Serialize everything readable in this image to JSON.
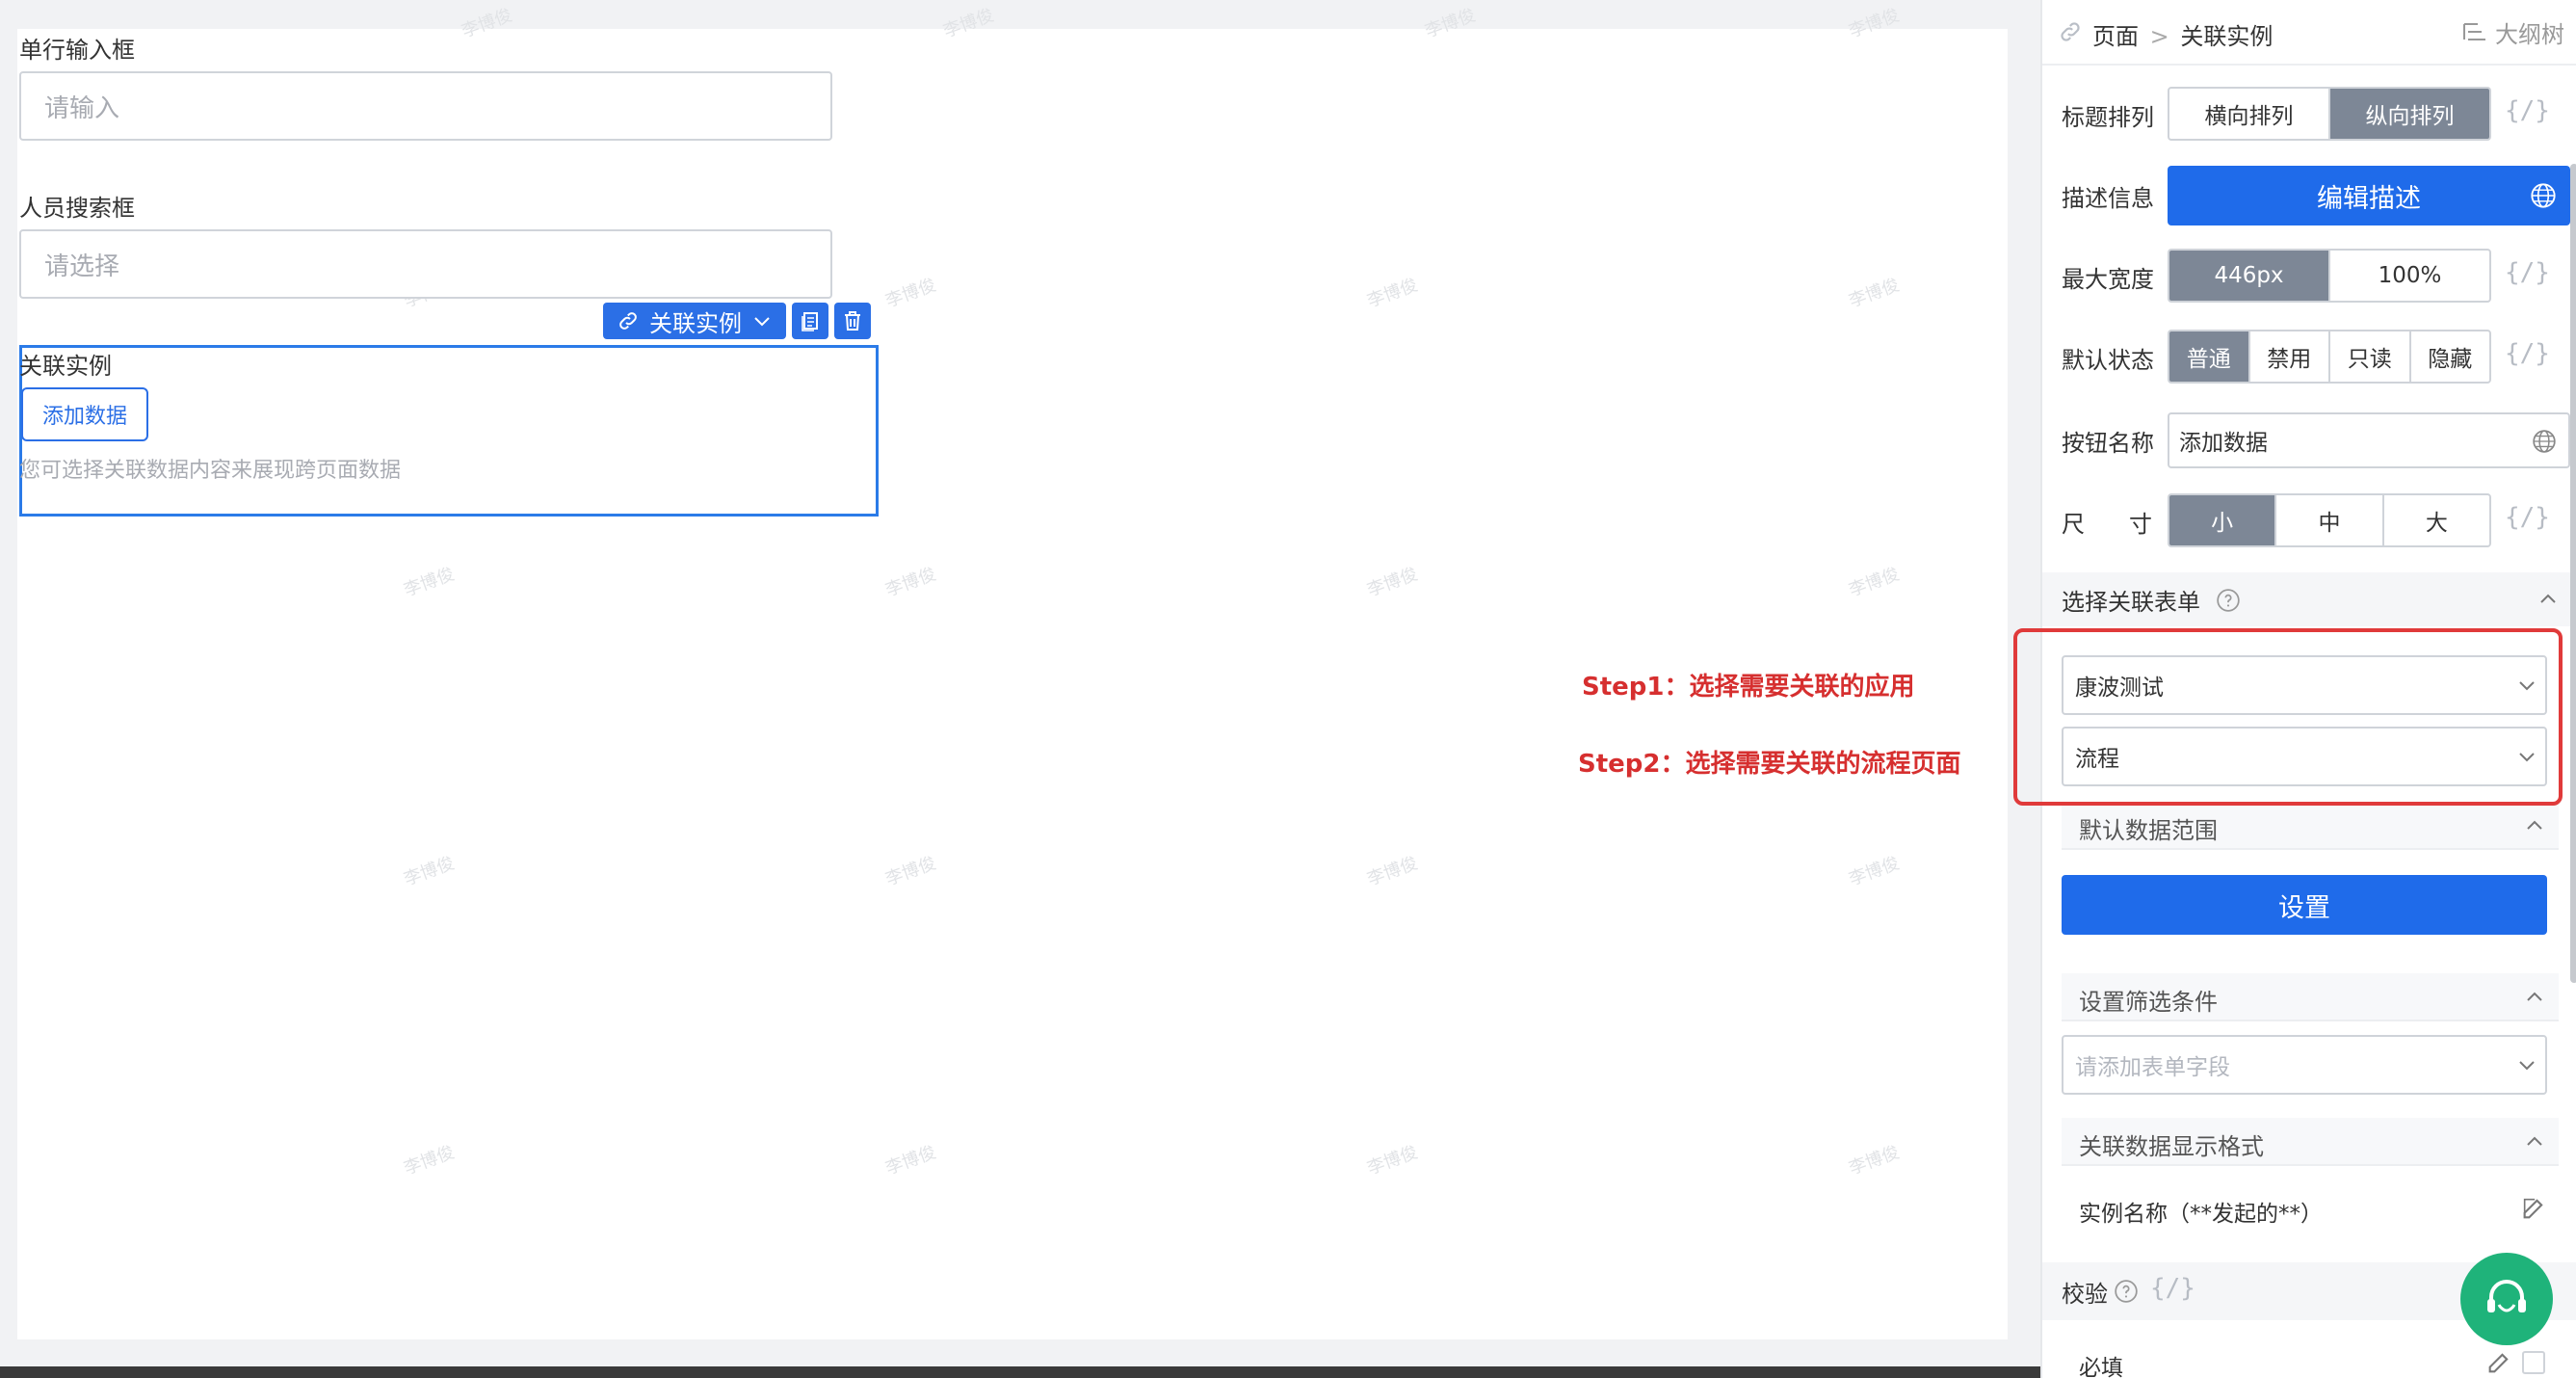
{
  "canvas": {
    "single_input": {
      "label": "单行输入框",
      "placeholder": "请输入"
    },
    "person_search": {
      "label": "人员搜索框",
      "placeholder": "请选择"
    },
    "toolbar": {
      "component_name": "关联实例"
    },
    "association": {
      "label": "关联实例",
      "add_button": "添加数据",
      "hint": "您可选择关联数据内容来展现跨页面数据"
    },
    "watermark": "李博俊",
    "annotations": {
      "step1": "Step1：选择需要关联的应用",
      "step2": "Step2：选择需要关联的流程页面"
    }
  },
  "panel": {
    "breadcrumb": {
      "root": "页面",
      "separator": ">",
      "current": "关联实例"
    },
    "outline_tab": "大纲树",
    "title_layout": {
      "label": "标题排列",
      "options": [
        "横向排列",
        "纵向排列"
      ],
      "selected": "纵向排列"
    },
    "description": {
      "label": "描述信息",
      "button": "编辑描述"
    },
    "max_width": {
      "label": "最大宽度",
      "options": [
        "446px",
        "100%"
      ],
      "selected": "446px"
    },
    "default_state": {
      "label": "默认状态",
      "options": [
        "普通",
        "禁用",
        "只读",
        "隐藏"
      ],
      "selected": "普通"
    },
    "button_name": {
      "label": "按钮名称",
      "value": "添加数据"
    },
    "size": {
      "label_a": "尺",
      "label_b": "寸",
      "options": [
        "小",
        "中",
        "大"
      ],
      "selected": "小"
    },
    "expr_symbol": "{/}",
    "select_form": {
      "title": "选择关联表单",
      "app_value": "康波测试",
      "page_value": "流程"
    },
    "default_range": {
      "title": "默认数据范围",
      "button": "设置"
    },
    "filter": {
      "title": "设置筛选条件",
      "placeholder": "请添加表单字段"
    },
    "display_format": {
      "title": "关联数据显示格式",
      "value": "实例名称（**发起的**）"
    },
    "validation": {
      "title": "校验",
      "required": "必填"
    }
  },
  "colors": {
    "primary": "#1f6bea",
    "selected_segment": "#7d8796",
    "annotation_red": "#d62f2f",
    "chat": "#1fb37a"
  }
}
